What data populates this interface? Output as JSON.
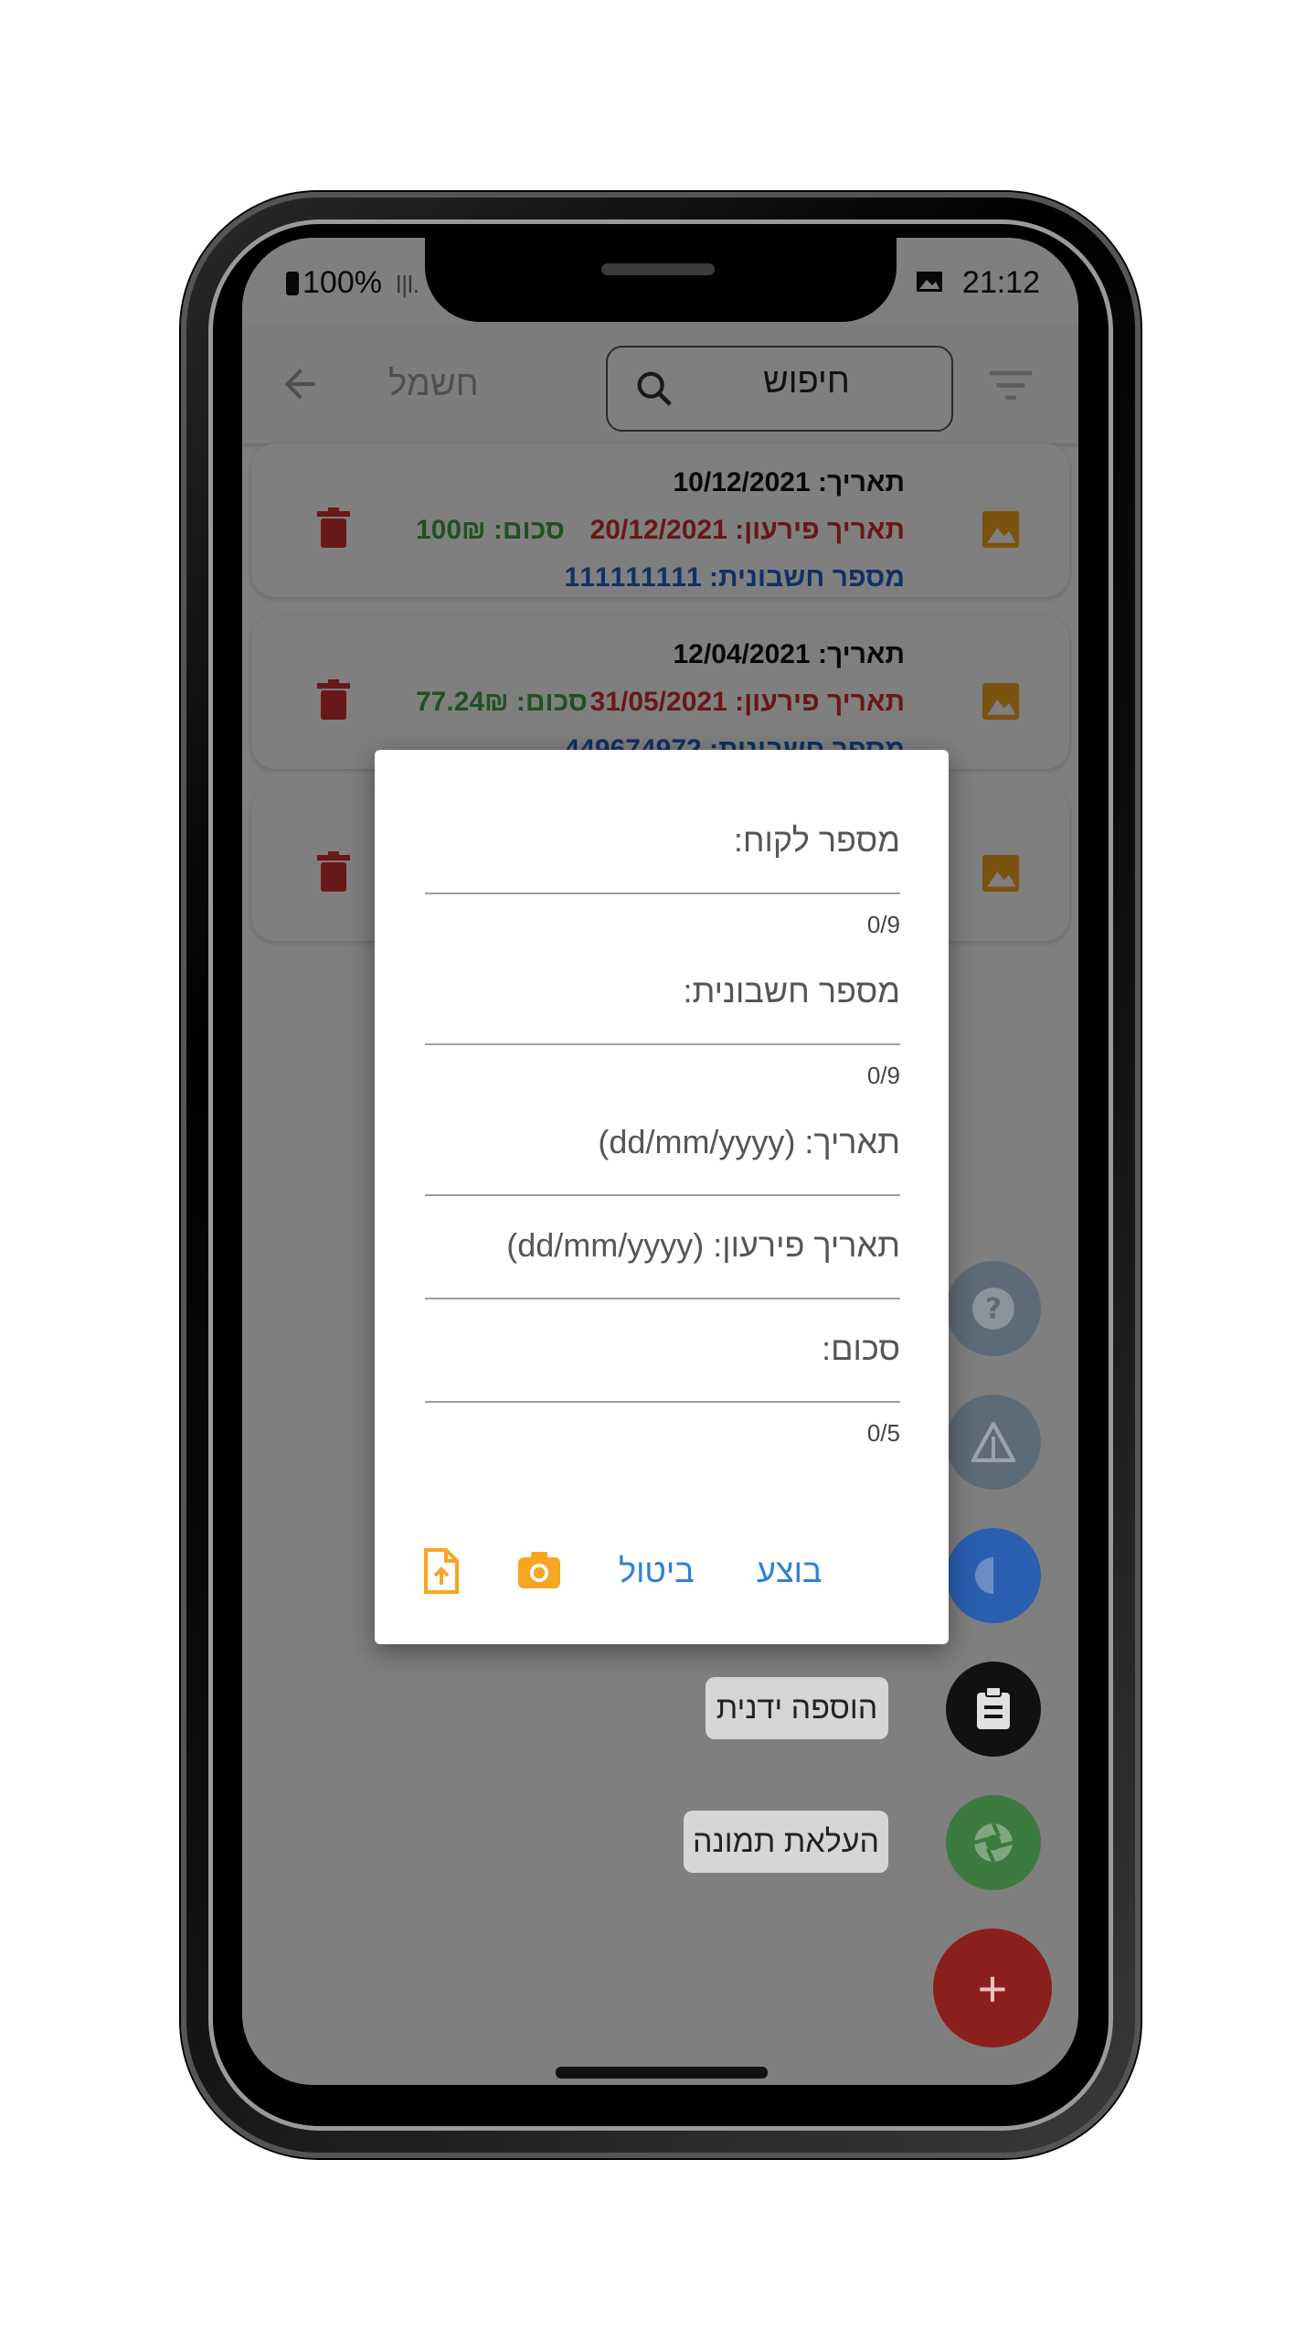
{
  "status_bar": {
    "battery": "100%",
    "signal": "l|l.",
    "time": "21:12"
  },
  "app_bar": {
    "title": "חשמל",
    "search_placeholder": "חיפוש"
  },
  "invoices": [
    {
      "date": "תאריך: 10/12/2021",
      "due_date": "תאריך פירעון: 20/12/2021",
      "amount": "סכום: 100₪",
      "invoice_number": "מספר חשבונית: 111111111"
    },
    {
      "date": "תאריך: 12/04/2021",
      "due_date": "תאריך פירעון: 31/05/2021",
      "amount": "סכום: 77.24₪",
      "invoice_number": "מספר חשבונית: 449674972"
    },
    {
      "date": "",
      "due_date": "",
      "amount": "",
      "invoice_number": ""
    }
  ],
  "dialog": {
    "customer_number_label": "מספר לקוח:",
    "customer_number_counter": "0/9",
    "invoice_number_label": "מספר חשבונית:",
    "invoice_number_counter": "0/9",
    "date_label": "תאריך: (dd/mm/yyyy)",
    "due_date_label": "תאריך פירעון: (dd/mm/yyyy)",
    "amount_label": "סכום:",
    "amount_counter": "0/5",
    "submit_label": "בוצע",
    "cancel_label": "ביטול"
  },
  "fab_menu": {
    "manual_add_label": "הוספה ידנית",
    "upload_image_label": "העלאת תמונה",
    "add_symbol": "+"
  },
  "colors": {
    "trash": "#d32f2f",
    "image_icon": "#f5a623",
    "due_date": "#d32f2f",
    "amount": "#43a047",
    "invoice_number": "#1e63c7",
    "dialog_button": "#2f80d6",
    "dialog_icon": "#f5a623",
    "fab_help": "#5d6b78",
    "fab_warning": "#5d6b78",
    "fab_chart": "#2a73d9",
    "fab_manual": "#111111",
    "fab_camera": "#4caf50",
    "fab_add": "#e53935"
  }
}
